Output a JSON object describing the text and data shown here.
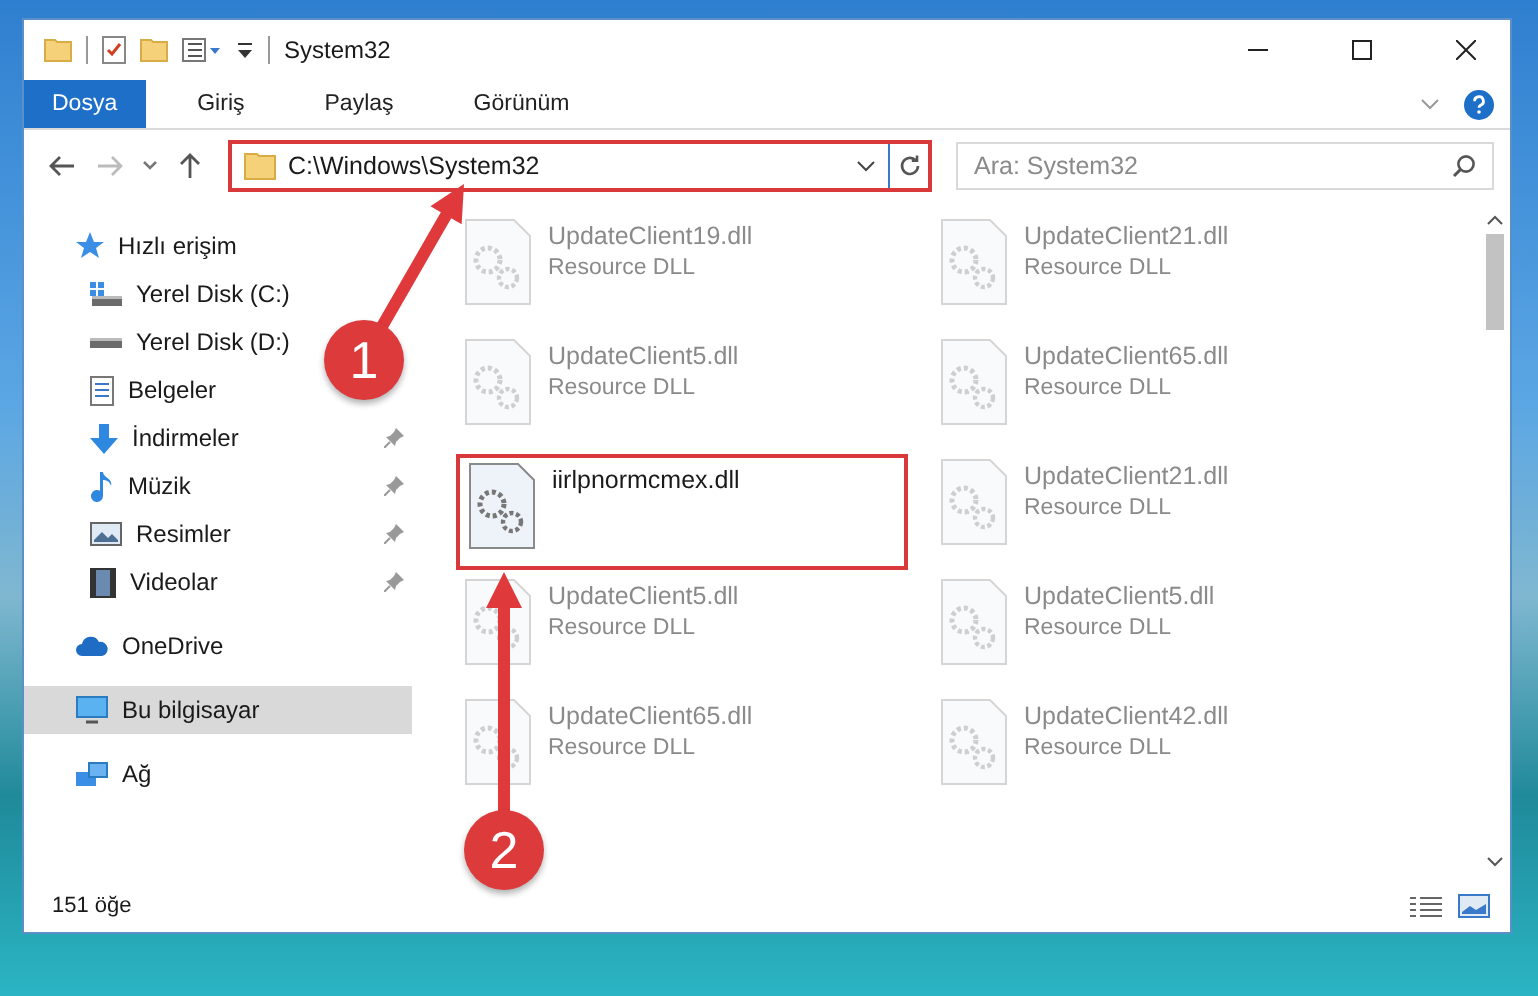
{
  "window": {
    "title": "System32"
  },
  "ribbon": {
    "tabs": [
      {
        "label": "Dosya",
        "selected": true
      },
      {
        "label": "Giriş",
        "selected": false
      },
      {
        "label": "Paylaş",
        "selected": false
      },
      {
        "label": "Görünüm",
        "selected": false
      }
    ]
  },
  "nav_buttons": [
    {
      "kind": "back",
      "disabled": false
    },
    {
      "kind": "forward",
      "disabled": true
    },
    {
      "kind": "recent",
      "disabled": false
    },
    {
      "kind": "up",
      "disabled": false
    }
  ],
  "address_bar": {
    "path": "C:\\Windows\\System32",
    "highlighted": true
  },
  "search": {
    "placeholder": "Ara: System32"
  },
  "sidebar": {
    "items": [
      {
        "label": "Hızlı erişim",
        "selected": false,
        "children": [
          {
            "label": "Yerel Disk (C:)",
            "pinned": false,
            "selected": false
          },
          {
            "label": "Yerel Disk (D:)",
            "pinned": false,
            "selected": false
          },
          {
            "label": "Belgeler",
            "pinned": false,
            "selected": false
          },
          {
            "label": "İndirmeler",
            "pinned": true,
            "selected": false
          },
          {
            "label": "Müzik",
            "pinned": true,
            "selected": false
          },
          {
            "label": "Resimler",
            "pinned": true,
            "selected": false
          },
          {
            "label": "Videolar",
            "pinned": true,
            "selected": false
          }
        ]
      },
      {
        "label": "OneDrive",
        "selected": false
      },
      {
        "label": "Bu bilgisayar",
        "selected": true
      },
      {
        "label": "Ağ",
        "selected": false
      }
    ]
  },
  "files": [
    {
      "name": "UpdateClient19.dll",
      "type": "Resource DLL",
      "faded": true,
      "highlighted": false
    },
    {
      "name": "UpdateClient21.dll",
      "type": "Resource DLL",
      "faded": true,
      "highlighted": false
    },
    {
      "name": "UpdateClient5.dll",
      "type": "Resource DLL",
      "faded": true,
      "highlighted": false
    },
    {
      "name": "UpdateClient65.dll",
      "type": "Resource DLL",
      "faded": true,
      "highlighted": false
    },
    {
      "name": "iirlpnormcmex.dll",
      "faded": false,
      "highlighted": true
    },
    {
      "name": "UpdateClient21.dll",
      "type": "Resource DLL",
      "faded": true,
      "highlighted": false
    },
    {
      "name": "UpdateClient5.dll",
      "type": "Resource DLL",
      "faded": true,
      "highlighted": false
    },
    {
      "name": "UpdateClient5.dll",
      "type": "Resource DLL",
      "faded": true,
      "highlighted": false
    },
    {
      "name": "UpdateClient65.dll",
      "type": "Resource DLL",
      "faded": true,
      "highlighted": false
    },
    {
      "name": "UpdateClient42.dll",
      "type": "Resource DLL",
      "faded": true,
      "highlighted": false
    }
  ],
  "annotations": [
    {
      "label": "1"
    },
    {
      "label": "2"
    }
  ],
  "status_bar": {
    "count": "151 öğe"
  }
}
